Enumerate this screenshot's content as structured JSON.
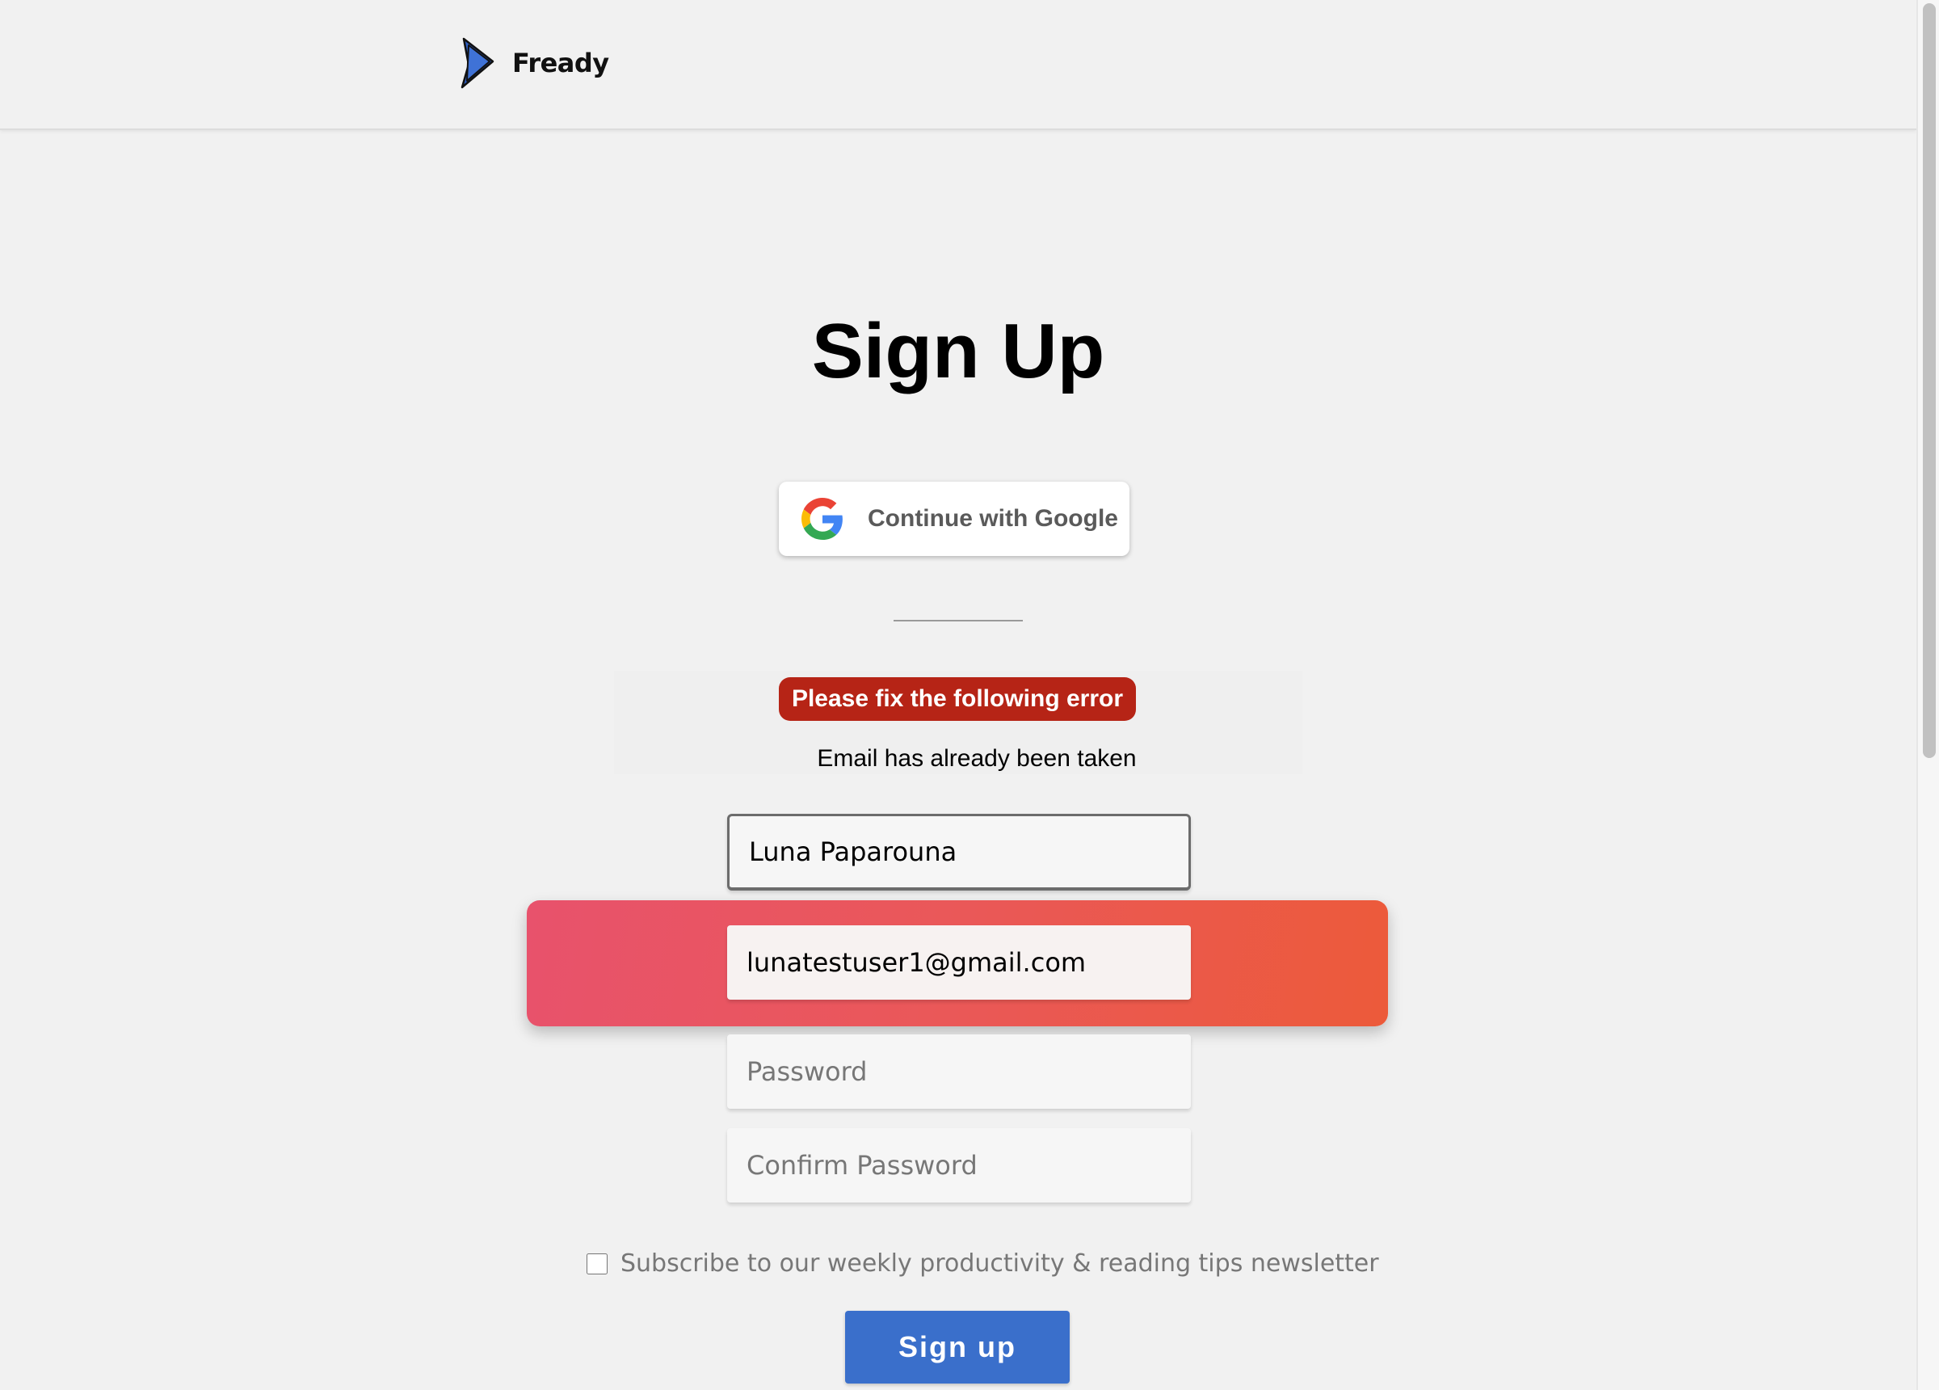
{
  "header": {
    "logo_text": "Fready",
    "logo_icon": "play-triangle-icon",
    "brand_color": "#3a6fcb"
  },
  "page": {
    "title": "Sign Up"
  },
  "google_button": {
    "label": "Continue with Google",
    "icon": "google-g-icon"
  },
  "errors": {
    "badge": "Please fix the following error",
    "messages": [
      "Email has already been taken"
    ],
    "badge_color": "#b62416",
    "highlight_color": "#ea5858"
  },
  "form": {
    "name": {
      "value": "Luna Paparouna",
      "placeholder": ""
    },
    "email": {
      "value": "lunatestuser1@gmail.com",
      "placeholder": ""
    },
    "password": {
      "value": "",
      "placeholder": "Password"
    },
    "confirm_password": {
      "value": "",
      "placeholder": "Confirm Password"
    },
    "newsletter_label": "Subscribe to our weekly productivity & reading tips newsletter",
    "newsletter_checked": false,
    "submit_label": "Sign up"
  }
}
